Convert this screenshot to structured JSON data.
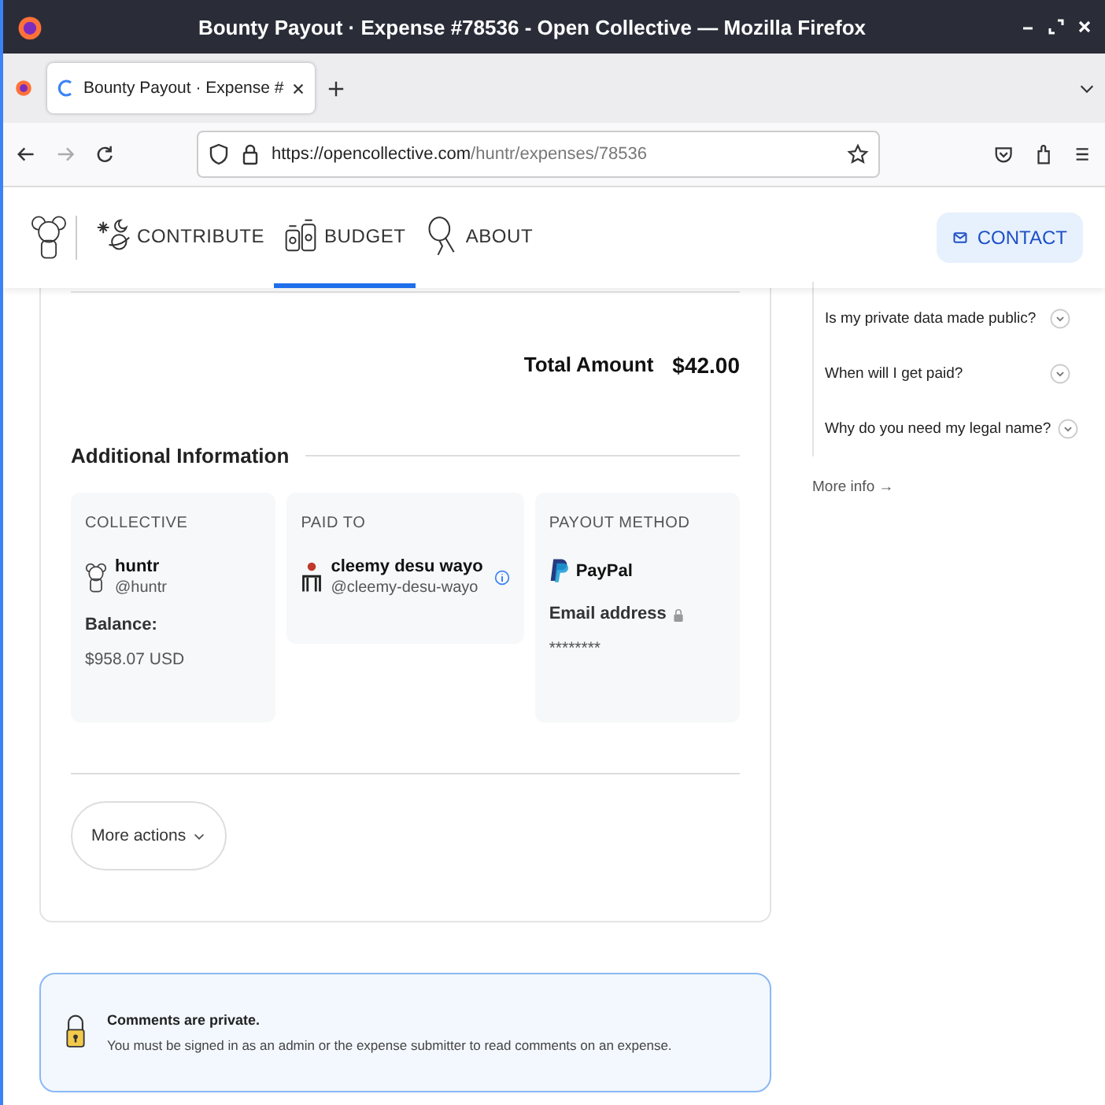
{
  "window": {
    "title": "Bounty Payout · Expense #78536 - Open Collective — Mozilla Firefox"
  },
  "tabs": [
    {
      "label": "Bounty Payout · Expense #",
      "selected": true,
      "loading": true
    }
  ],
  "address_bar": {
    "domain": "https://opencollective.com",
    "path": "/huntr/expenses/78536"
  },
  "site_nav": {
    "items": [
      {
        "label": "CONTRIBUTE",
        "selected": false
      },
      {
        "label": "BUDGET",
        "selected": true
      },
      {
        "label": "ABOUT",
        "selected": false
      }
    ],
    "contact_button": "CONTACT"
  },
  "expense": {
    "total_label": "Total Amount",
    "total_value": "$42.00",
    "section_title": "Additional Information",
    "collective": {
      "heading": "COLLECTIVE",
      "name": "huntr",
      "handle": "@huntr",
      "balance_label": "Balance:",
      "balance": "$958.07 USD"
    },
    "paid_to": {
      "heading": "PAID TO",
      "name": "cleemy desu wayo",
      "handle": "@cleemy-desu-wayo"
    },
    "payout_method": {
      "heading": "PAYOUT METHOD",
      "method": "PayPal",
      "field_label": "Email address",
      "field_value": "********"
    },
    "more_actions": "More actions"
  },
  "faq": {
    "items": [
      "Is my private data made public?",
      "When will I get paid?",
      "Why do you need my legal name?"
    ],
    "more_info": "More info →"
  },
  "comments_notice": {
    "title": "Comments are private.",
    "text": "You must be signed in as an admin or the expense submitter to read comments on an expense."
  }
}
